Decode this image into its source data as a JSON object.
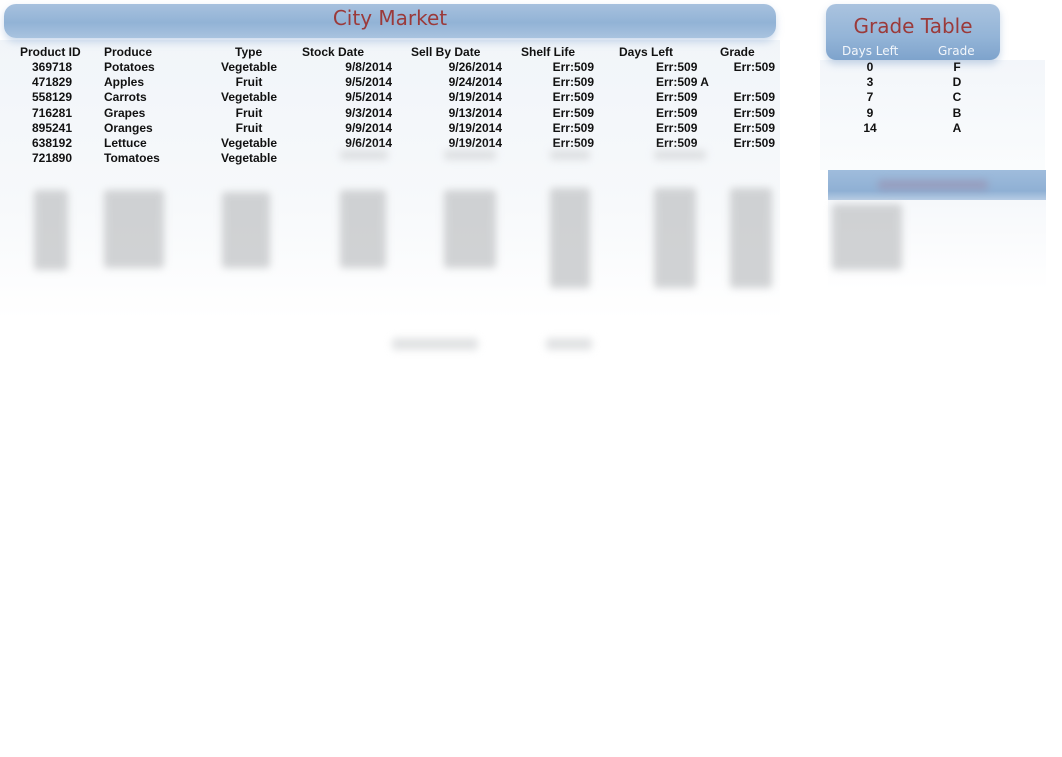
{
  "main_table": {
    "title": "City Market",
    "columns": [
      "Product ID",
      "Produce",
      "Type",
      "Stock Date",
      "Sell By Date",
      "Shelf Life",
      "Days Left",
      "Grade"
    ],
    "rows": [
      {
        "product_id": "369718",
        "produce": "Potatoes",
        "type": "Vegetable",
        "stock_date": "9/8/2014",
        "sell_by": "9/26/2014",
        "shelf_life": "Err:509",
        "days_left": "Err:509",
        "grade": "Err:509"
      },
      {
        "product_id": "471829",
        "produce": "Apples",
        "type": "Fruit",
        "stock_date": "9/5/2014",
        "sell_by": "9/24/2014",
        "shelf_life": "Err:509",
        "days_left": "Err:509 A",
        "grade": ""
      },
      {
        "product_id": "558129",
        "produce": "Carrots",
        "type": "Vegetable",
        "stock_date": "9/5/2014",
        "sell_by": "9/19/2014",
        "shelf_life": "Err:509",
        "days_left": "Err:509",
        "grade": "Err:509"
      },
      {
        "product_id": "716281",
        "produce": "Grapes",
        "type": "Fruit",
        "stock_date": "9/3/2014",
        "sell_by": "9/13/2014",
        "shelf_life": "Err:509",
        "days_left": "Err:509",
        "grade": "Err:509"
      },
      {
        "product_id": "895241",
        "produce": "Oranges",
        "type": "Fruit",
        "stock_date": "9/9/2014",
        "sell_by": "9/19/2014",
        "shelf_life": "Err:509",
        "days_left": "Err:509",
        "grade": "Err:509"
      },
      {
        "product_id": "638192",
        "produce": "Lettuce",
        "type": "Vegetable",
        "stock_date": "9/6/2014",
        "sell_by": "9/19/2014",
        "shelf_life": "Err:509",
        "days_left": "Err:509",
        "grade": "Err:509"
      },
      {
        "product_id": "721890",
        "produce": "Tomatoes",
        "type": "Vegetable",
        "stock_date": "",
        "sell_by": "",
        "shelf_life": "",
        "days_left": "",
        "grade": ""
      }
    ]
  },
  "grade_table": {
    "title": "Grade Table",
    "columns": [
      "Days Left",
      "Grade"
    ],
    "rows": [
      {
        "days_left": "0",
        "grade": "F"
      },
      {
        "days_left": "3",
        "grade": "D"
      },
      {
        "days_left": "7",
        "grade": "C"
      },
      {
        "days_left": "9",
        "grade": "B"
      },
      {
        "days_left": "14",
        "grade": "A"
      }
    ]
  },
  "colors": {
    "title_text": "#9b3a3a",
    "banner_blue": "#92b3d6",
    "header_text_light": "#f2f6fb"
  }
}
